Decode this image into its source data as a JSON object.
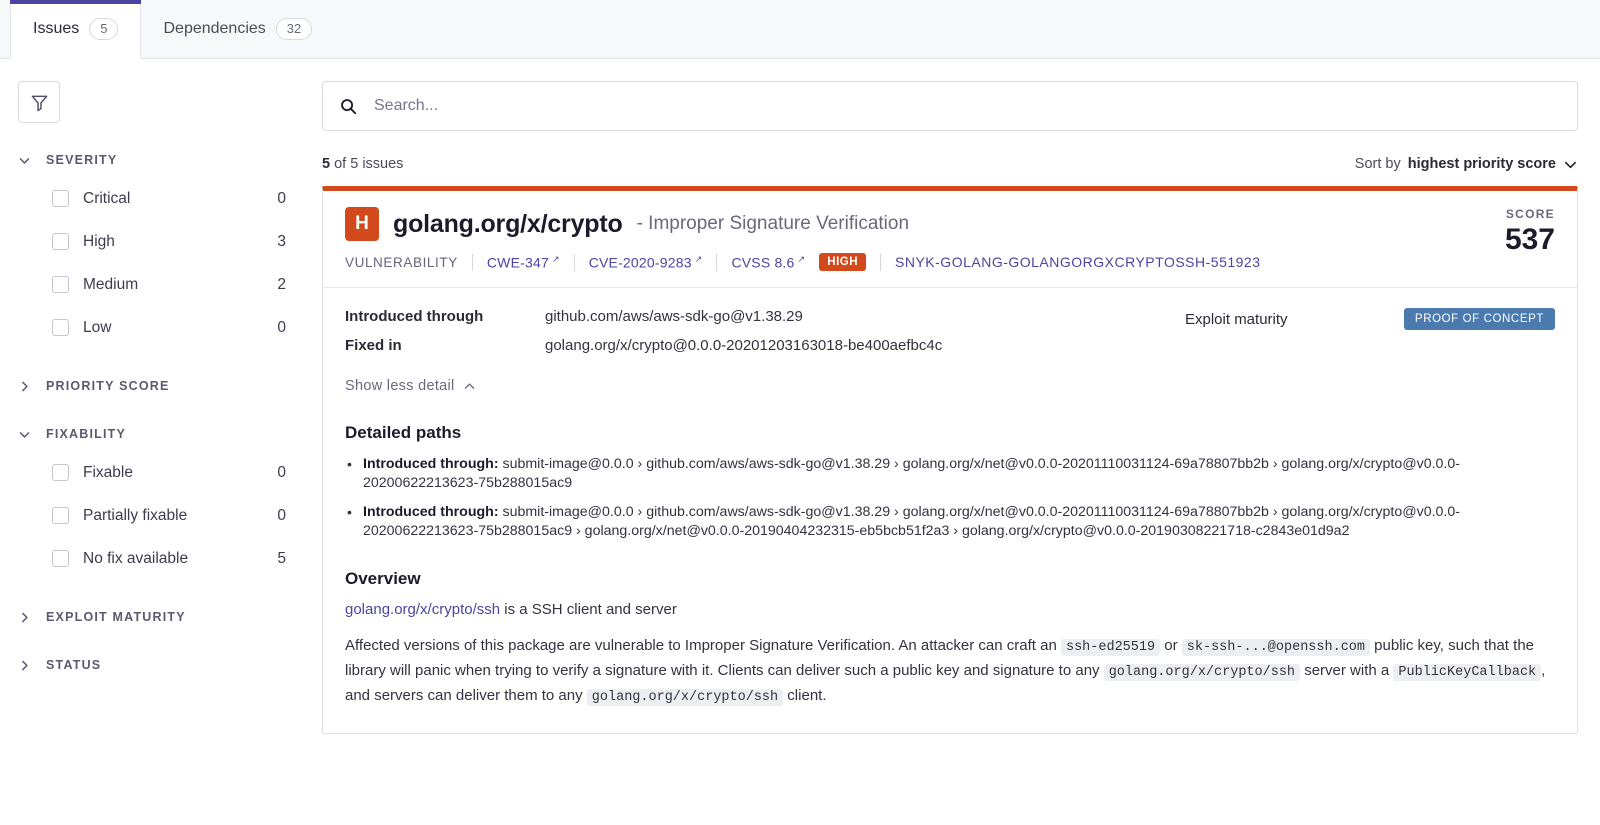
{
  "tabs": [
    {
      "label": "Issues",
      "count": "5",
      "active": true
    },
    {
      "label": "Dependencies",
      "count": "32",
      "active": false
    }
  ],
  "sidebar": {
    "filter_button_icon": "funnel-icon",
    "facets": [
      {
        "title": "SEVERITY",
        "expanded": true,
        "options": [
          {
            "label": "Critical",
            "count": "0"
          },
          {
            "label": "High",
            "count": "3"
          },
          {
            "label": "Medium",
            "count": "2"
          },
          {
            "label": "Low",
            "count": "0"
          }
        ]
      },
      {
        "title": "PRIORITY SCORE",
        "expanded": false,
        "options": []
      },
      {
        "title": "FIXABILITY",
        "expanded": true,
        "options": [
          {
            "label": "Fixable",
            "count": "0"
          },
          {
            "label": "Partially fixable",
            "count": "0"
          },
          {
            "label": "No fix available",
            "count": "5"
          }
        ]
      },
      {
        "title": "EXPLOIT MATURITY",
        "expanded": false,
        "options": []
      },
      {
        "title": "STATUS",
        "expanded": false,
        "options": []
      }
    ]
  },
  "search": {
    "placeholder": "Search...",
    "value": "",
    "icon": "search-icon"
  },
  "results": {
    "count_text_bold": "5",
    "count_text_rest": " of 5 issues",
    "sort_prefix": "Sort by ",
    "sort_value": "highest priority score"
  },
  "issue": {
    "severity_letter": "H",
    "severity_color": "#d2491c",
    "package": "golang.org/x/crypto",
    "title_suffix": " - Improper Signature Verification",
    "meta": {
      "type": "VULNERABILITY",
      "cwe": "CWE-347",
      "cve": "CVE-2020-9283",
      "cvss": "CVSS 8.6",
      "severity_tag": "HIGH",
      "snyk_id": "SNYK-GOLANG-GOLANGORGXCRYPTOSSH-551923"
    },
    "score_label": "SCORE",
    "score_value": "537",
    "details": {
      "introduced_through_key": "Introduced through",
      "introduced_through_value": "github.com/aws/aws-sdk-go@v1.38.29",
      "fixed_in_key": "Fixed in",
      "fixed_in_value": "golang.org/x/crypto@0.0.0-20201203163018-be400aefbc4c",
      "exploit_maturity_key": "Exploit maturity",
      "exploit_maturity_value": "PROOF OF CONCEPT",
      "exploit_maturity_color": "#4a7aae"
    },
    "show_detail_toggle": "Show less detail",
    "detailed_paths_title": "Detailed paths",
    "detailed_paths": [
      {
        "lead": "Introduced through:",
        "path": " submit-image@0.0.0 › github.com/aws/aws-sdk-go@v1.38.29 › golang.org/x/net@v0.0.0-20201110031124-69a78807bb2b › golang.org/x/crypto@v0.0.0-20200622213623-75b288015ac9"
      },
      {
        "lead": "Introduced through:",
        "path": " submit-image@0.0.0 › github.com/aws/aws-sdk-go@v1.38.29 › golang.org/x/net@v0.0.0-20201110031124-69a78807bb2b › golang.org/x/crypto@v0.0.0-20200622213623-75b288015ac9 › golang.org/x/net@v0.0.0-20190404232315-eb5bcb51f2a3 › golang.org/x/crypto@v0.0.0-20190308221718-c2843e01d9a2"
      }
    ],
    "overview_title": "Overview",
    "overview_link": "golang.org/x/crypto/ssh",
    "overview_link_tail": " is a SSH client and server",
    "overview_parts": {
      "p1": "Affected versions of this package are vulnerable to Improper Signature Verification. An attacker can craft an ",
      "code1": "ssh-ed25519",
      "p2": " or ",
      "code2": "sk-ssh-...@openssh.com",
      "p3": " public key, such that the library will panic when trying to verify a signature with it. Clients can deliver such a public key and signature to any ",
      "code3": "golang.org/x/crypto/ssh",
      "p4": " server with a ",
      "code4": "PublicKeyCallback",
      "p5": ", and servers can deliver them to any ",
      "code5": "golang.org/x/crypto/ssh",
      "p6": " client."
    }
  },
  "colors": {
    "accent_purple": "#4b45a1",
    "accent_orange": "#d2491c",
    "badge_blue": "#4a7aae"
  }
}
